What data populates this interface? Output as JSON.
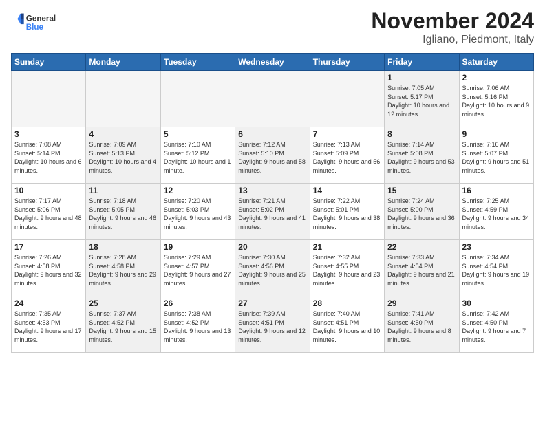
{
  "header": {
    "logo_general": "General",
    "logo_blue": "Blue",
    "month_title": "November 2024",
    "location": "Igliano, Piedmont, Italy"
  },
  "weekdays": [
    "Sunday",
    "Monday",
    "Tuesday",
    "Wednesday",
    "Thursday",
    "Friday",
    "Saturday"
  ],
  "weeks": [
    [
      {
        "day": "",
        "info": "",
        "empty": true
      },
      {
        "day": "",
        "info": "",
        "empty": true
      },
      {
        "day": "",
        "info": "",
        "empty": true
      },
      {
        "day": "",
        "info": "",
        "empty": true
      },
      {
        "day": "",
        "info": "",
        "empty": true
      },
      {
        "day": "1",
        "info": "Sunrise: 7:05 AM\nSunset: 5:17 PM\nDaylight: 10 hours and 12 minutes.",
        "shaded": true
      },
      {
        "day": "2",
        "info": "Sunrise: 7:06 AM\nSunset: 5:16 PM\nDaylight: 10 hours and 9 minutes.",
        "shaded": false
      }
    ],
    [
      {
        "day": "3",
        "info": "Sunrise: 7:08 AM\nSunset: 5:14 PM\nDaylight: 10 hours and 6 minutes.",
        "shaded": false
      },
      {
        "day": "4",
        "info": "Sunrise: 7:09 AM\nSunset: 5:13 PM\nDaylight: 10 hours and 4 minutes.",
        "shaded": true
      },
      {
        "day": "5",
        "info": "Sunrise: 7:10 AM\nSunset: 5:12 PM\nDaylight: 10 hours and 1 minute.",
        "shaded": false
      },
      {
        "day": "6",
        "info": "Sunrise: 7:12 AM\nSunset: 5:10 PM\nDaylight: 9 hours and 58 minutes.",
        "shaded": true
      },
      {
        "day": "7",
        "info": "Sunrise: 7:13 AM\nSunset: 5:09 PM\nDaylight: 9 hours and 56 minutes.",
        "shaded": false
      },
      {
        "day": "8",
        "info": "Sunrise: 7:14 AM\nSunset: 5:08 PM\nDaylight: 9 hours and 53 minutes.",
        "shaded": true
      },
      {
        "day": "9",
        "info": "Sunrise: 7:16 AM\nSunset: 5:07 PM\nDaylight: 9 hours and 51 minutes.",
        "shaded": false
      }
    ],
    [
      {
        "day": "10",
        "info": "Sunrise: 7:17 AM\nSunset: 5:06 PM\nDaylight: 9 hours and 48 minutes.",
        "shaded": false
      },
      {
        "day": "11",
        "info": "Sunrise: 7:18 AM\nSunset: 5:05 PM\nDaylight: 9 hours and 46 minutes.",
        "shaded": true
      },
      {
        "day": "12",
        "info": "Sunrise: 7:20 AM\nSunset: 5:03 PM\nDaylight: 9 hours and 43 minutes.",
        "shaded": false
      },
      {
        "day": "13",
        "info": "Sunrise: 7:21 AM\nSunset: 5:02 PM\nDaylight: 9 hours and 41 minutes.",
        "shaded": true
      },
      {
        "day": "14",
        "info": "Sunrise: 7:22 AM\nSunset: 5:01 PM\nDaylight: 9 hours and 38 minutes.",
        "shaded": false
      },
      {
        "day": "15",
        "info": "Sunrise: 7:24 AM\nSunset: 5:00 PM\nDaylight: 9 hours and 36 minutes.",
        "shaded": true
      },
      {
        "day": "16",
        "info": "Sunrise: 7:25 AM\nSunset: 4:59 PM\nDaylight: 9 hours and 34 minutes.",
        "shaded": false
      }
    ],
    [
      {
        "day": "17",
        "info": "Sunrise: 7:26 AM\nSunset: 4:58 PM\nDaylight: 9 hours and 32 minutes.",
        "shaded": false
      },
      {
        "day": "18",
        "info": "Sunrise: 7:28 AM\nSunset: 4:58 PM\nDaylight: 9 hours and 29 minutes.",
        "shaded": true
      },
      {
        "day": "19",
        "info": "Sunrise: 7:29 AM\nSunset: 4:57 PM\nDaylight: 9 hours and 27 minutes.",
        "shaded": false
      },
      {
        "day": "20",
        "info": "Sunrise: 7:30 AM\nSunset: 4:56 PM\nDaylight: 9 hours and 25 minutes.",
        "shaded": true
      },
      {
        "day": "21",
        "info": "Sunrise: 7:32 AM\nSunset: 4:55 PM\nDaylight: 9 hours and 23 minutes.",
        "shaded": false
      },
      {
        "day": "22",
        "info": "Sunrise: 7:33 AM\nSunset: 4:54 PM\nDaylight: 9 hours and 21 minutes.",
        "shaded": true
      },
      {
        "day": "23",
        "info": "Sunrise: 7:34 AM\nSunset: 4:54 PM\nDaylight: 9 hours and 19 minutes.",
        "shaded": false
      }
    ],
    [
      {
        "day": "24",
        "info": "Sunrise: 7:35 AM\nSunset: 4:53 PM\nDaylight: 9 hours and 17 minutes.",
        "shaded": false
      },
      {
        "day": "25",
        "info": "Sunrise: 7:37 AM\nSunset: 4:52 PM\nDaylight: 9 hours and 15 minutes.",
        "shaded": true
      },
      {
        "day": "26",
        "info": "Sunrise: 7:38 AM\nSunset: 4:52 PM\nDaylight: 9 hours and 13 minutes.",
        "shaded": false
      },
      {
        "day": "27",
        "info": "Sunrise: 7:39 AM\nSunset: 4:51 PM\nDaylight: 9 hours and 12 minutes.",
        "shaded": true
      },
      {
        "day": "28",
        "info": "Sunrise: 7:40 AM\nSunset: 4:51 PM\nDaylight: 9 hours and 10 minutes.",
        "shaded": false
      },
      {
        "day": "29",
        "info": "Sunrise: 7:41 AM\nSunset: 4:50 PM\nDaylight: 9 hours and 8 minutes.",
        "shaded": true
      },
      {
        "day": "30",
        "info": "Sunrise: 7:42 AM\nSunset: 4:50 PM\nDaylight: 9 hours and 7 minutes.",
        "shaded": false
      }
    ]
  ]
}
